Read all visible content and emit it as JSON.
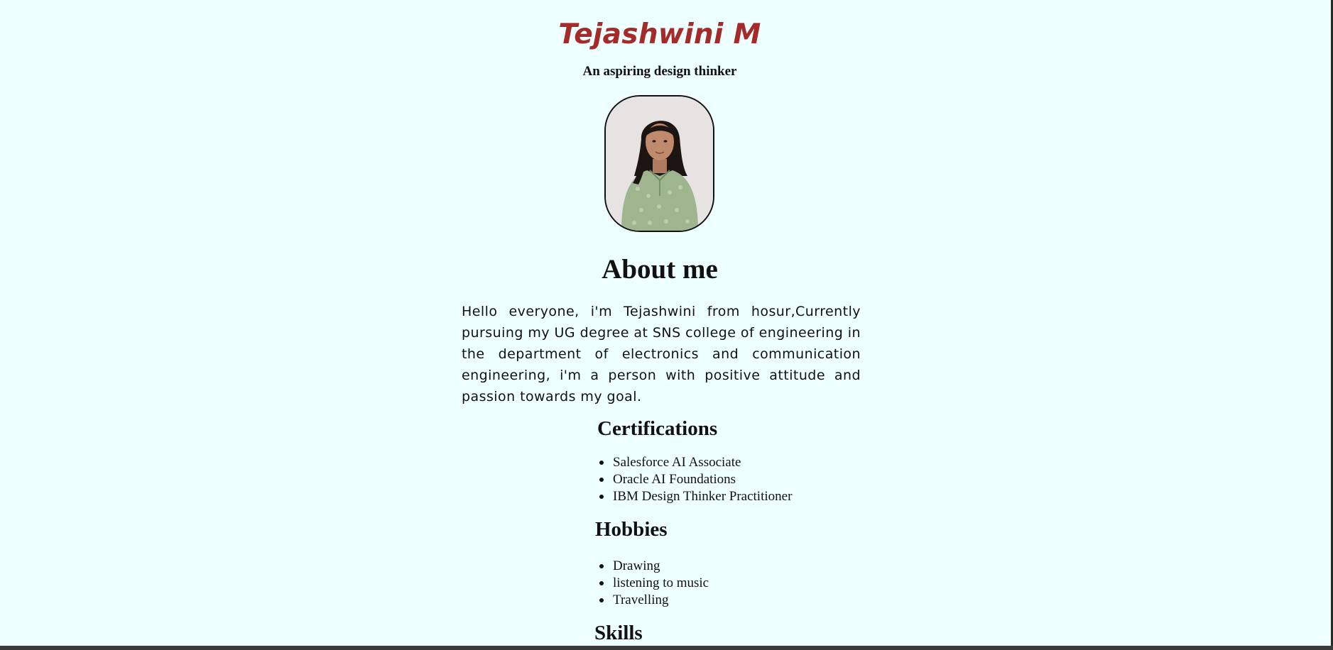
{
  "header": {
    "name": "Tejashwini M",
    "tagline": "An aspiring design thinker"
  },
  "profile_photo": {
    "alt": "Profile photo",
    "icon": "portrait-photo"
  },
  "about": {
    "title": "About me",
    "text": "Hello everyone, i'm Tejashwini from hosur,Currently pursuing my UG degree at SNS college of engineering in the department of electronics and communication engineering, i'm a person with positive attitude and passion towards my goal."
  },
  "certifications": {
    "title": "Certifications",
    "items": [
      "Salesforce AI Associate",
      "Oracle AI Foundations",
      "IBM Design Thinker Practitioner"
    ]
  },
  "hobbies": {
    "title": "Hobbies",
    "items": [
      "Drawing",
      "listening to music",
      "Travelling"
    ]
  },
  "skills": {
    "title": "Skills"
  },
  "colors": {
    "background": "#eeffff",
    "name_accent": "#a52a2a",
    "text": "#111111"
  }
}
